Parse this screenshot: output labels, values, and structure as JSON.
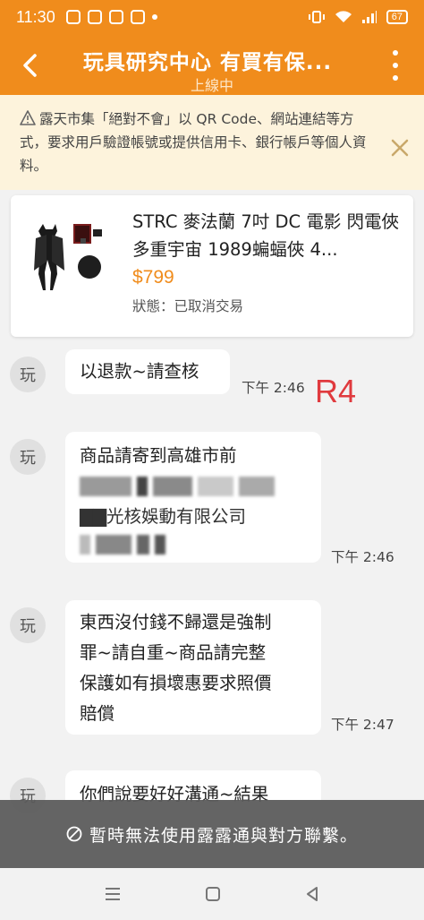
{
  "status_bar": {
    "time": "11:30",
    "battery": "67"
  },
  "header": {
    "title": "玩具研究中心 有買有保...",
    "subtitle": "上線中"
  },
  "warning": {
    "text": "露天市集「絕對不會」以 QR Code、網站連結等方式，要求用戶驗證帳號或提供信用卡、銀行帳戶等個人資料。"
  },
  "product": {
    "name": "STRC 麥法蘭 7吋 DC 電影 閃電俠 多重宇宙 1989蝙蝠俠 4...",
    "price": "$799",
    "status": "狀態：已取消交易"
  },
  "messages": [
    {
      "avatar": "玩",
      "lines": [
        "以退款~請查核"
      ],
      "time": "下午 2:46"
    },
    {
      "avatar": "玩",
      "lines": [
        "商品請寄到高雄市前",
        "▇▇光核娛動有限公司"
      ],
      "time": "下午 2:46"
    },
    {
      "avatar": "玩",
      "lines": [
        "東西沒付錢不歸還是強制",
        "罪~請自重~商品請完整",
        "保護如有損壞惠要求照價",
        "賠償"
      ],
      "time": "下午 2:47"
    },
    {
      "avatar": "玩",
      "lines": [
        "你們說要好好溝通~結果"
      ]
    }
  ],
  "annotation": {
    "text": "R4",
    "color": "#e03a3e"
  },
  "banner": {
    "text": "暫時無法使用露露通與對方聯繫。"
  },
  "colors": {
    "brand": "#f08c1c",
    "warning_bg": "#fdf3dc",
    "chat_bg": "#f2f2f2"
  }
}
